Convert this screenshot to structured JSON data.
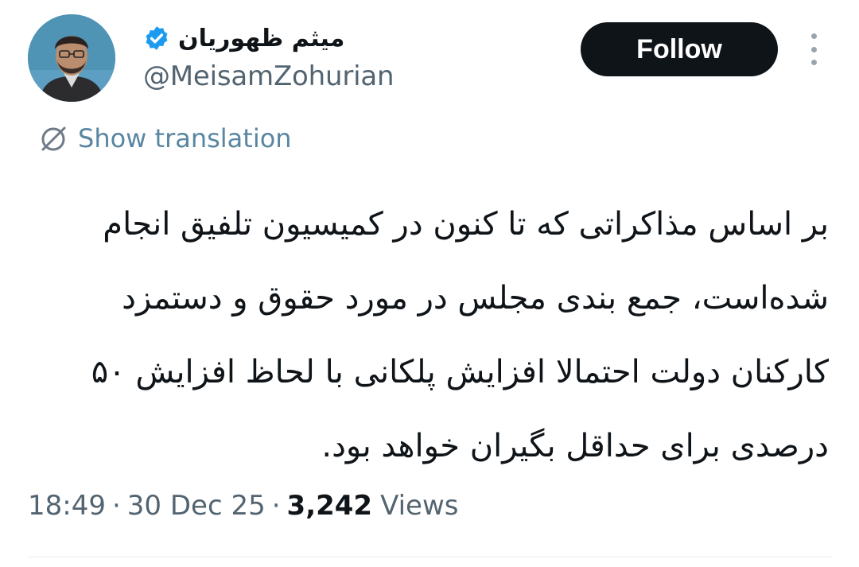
{
  "author": {
    "display_name": "میثم ظهوریان",
    "handle": "@MeisamZohurian",
    "verified": true
  },
  "actions": {
    "follow_label": "Follow",
    "more_icon": "more-vertical-icon"
  },
  "translation": {
    "label": "Show translation",
    "icon": "globe-icon"
  },
  "tweet": {
    "lines": [
      "بر اساس مذاکراتی که تا کنون در کمیسیون تلفیق انجام",
      "شده‌است، جمع بندی مجلس  در مورد حقوق و دستمزد",
      "کارکنان دولت احتمالا افزایش پلکانی با لحاظ افزایش ۵۰",
      "درصدی برای حداقل بگیران خواهد بود."
    ]
  },
  "meta": {
    "time": "18:49",
    "date": "30 Dec 25",
    "separator": "·",
    "views_count": "3,242",
    "views_label": "Views"
  },
  "colors": {
    "follow_bg": "#0f1419",
    "link": "#3a8cc0",
    "verified": "#1d9bf0",
    "secondary_text": "#536471"
  }
}
